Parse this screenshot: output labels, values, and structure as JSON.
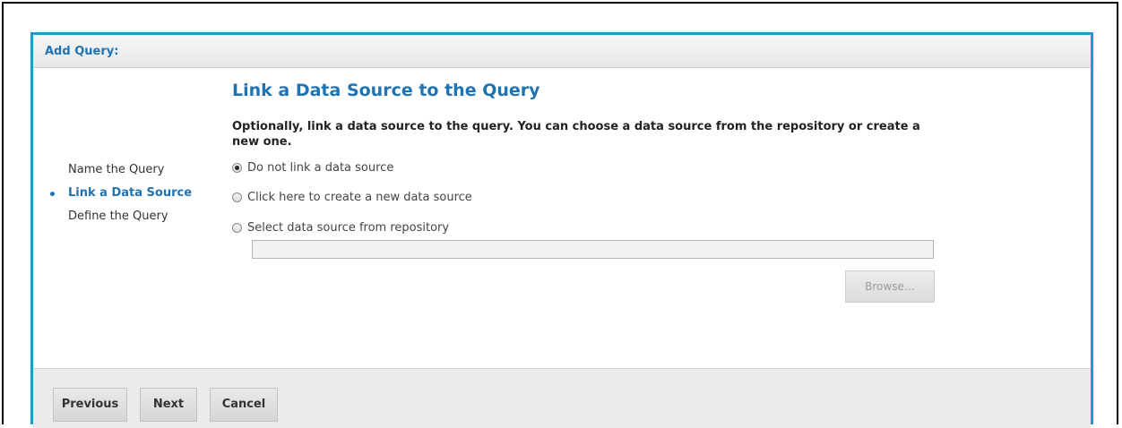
{
  "dialog": {
    "title": "Add Query:"
  },
  "steps": [
    {
      "label": "Name the Query",
      "active": false
    },
    {
      "label": "Link a Data Source",
      "active": true
    },
    {
      "label": "Define the Query",
      "active": false
    }
  ],
  "main": {
    "heading": "Link a Data Source to the Query",
    "description": "Optionally, link a data source to the query. You can choose a data source from the repository or create a new one.",
    "options": [
      {
        "label": "Do not link a data source",
        "checked": true
      },
      {
        "label": "Click here to create a new data source",
        "checked": false
      },
      {
        "label": "Select data source from repository",
        "checked": false
      }
    ],
    "repository_path": {
      "value": "",
      "placeholder": ""
    },
    "browse_label": "Browse…"
  },
  "footer": {
    "previous_label": "Previous",
    "next_label": "Next",
    "cancel_label": "Cancel"
  },
  "colors": {
    "accent": "#1f73b3",
    "dialog_border": "#2a95cf"
  }
}
